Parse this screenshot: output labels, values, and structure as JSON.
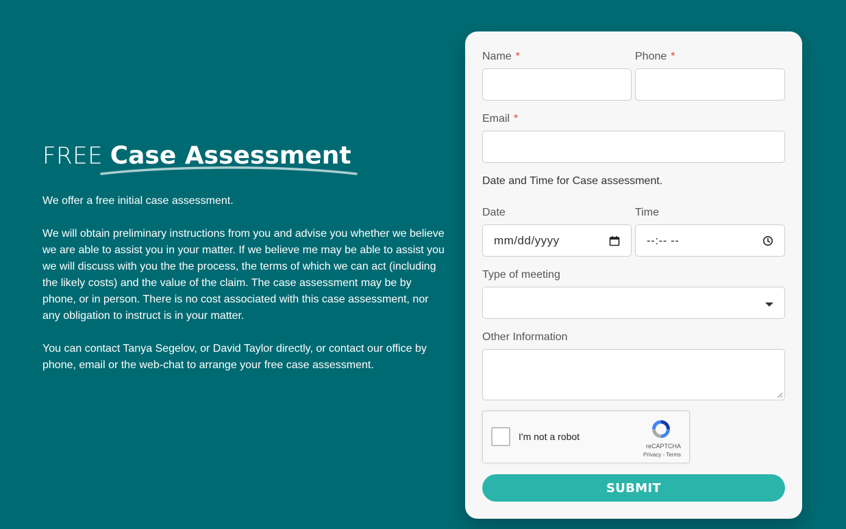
{
  "headline": {
    "prefix": "FREE",
    "emphasis": "Case Assessment"
  },
  "intro": {
    "paragraphs": [
      "We offer a free initial case assessment.",
      "We will obtain preliminary instructions from you and advise you whether we believe we are able to assist you in your matter. If we believe me may be able to assist you we will discuss with you the the process, the terms of which we can act (including the likely costs) and the value of the claim. The case assessment may be by phone, or in person. There is no cost associated with this case assessment, nor any obligation to instruct is in your matter.",
      "You can contact Tanya Segelov, or David Taylor directly, or contact our office by phone, email or the web-chat to arrange your free case assessment."
    ]
  },
  "form": {
    "name_label": "Name",
    "phone_label": "Phone",
    "email_label": "Email",
    "required_marker": "*",
    "datetime_heading": "Date and Time for Case assessment.",
    "date_label": "Date",
    "date_placeholder": "mm/dd/yyyy",
    "time_label": "Time",
    "time_placeholder": "--:-- --",
    "meeting_label": "Type of meeting",
    "meeting_value": "",
    "other_label": "Other Information",
    "other_value": "",
    "submit_label": "SUBMIT"
  },
  "recaptcha": {
    "label": "I'm not a robot",
    "brand": "reCAPTCHA",
    "links": "Privacy - Terms"
  },
  "colors": {
    "background": "#006a72",
    "card": "#f7f7f7",
    "accent": "#2bb5aa",
    "required": "#e23b3b"
  },
  "icons": {
    "date": "calendar-icon",
    "time": "clock-icon",
    "select": "caret-down-icon"
  }
}
